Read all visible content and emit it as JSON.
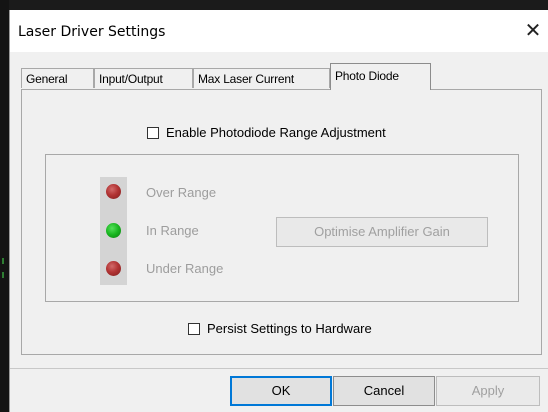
{
  "window": {
    "title": "Laser Driver Settings",
    "close_glyph": "✕"
  },
  "tabs": [
    {
      "label": "General",
      "active": false
    },
    {
      "label": "Input/Output",
      "active": false
    },
    {
      "label": "Max Laser Current",
      "active": false
    },
    {
      "label": "Photo Diode",
      "active": true
    }
  ],
  "photo_diode": {
    "enable_range_adjustment": {
      "label": "Enable Photodiode Range Adjustment",
      "checked": false
    },
    "indicators": [
      {
        "label": "Over Range",
        "color": "red"
      },
      {
        "label": "In Range",
        "color": "green"
      },
      {
        "label": "Under Range",
        "color": "red"
      }
    ],
    "optimise_button": {
      "label": "Optimise Amplifier Gain",
      "enabled": false
    },
    "persist_settings": {
      "label": "Persist Settings to Hardware",
      "checked": false
    }
  },
  "buttons": {
    "ok": "OK",
    "cancel": "Cancel",
    "apply": "Apply"
  },
  "colors": {
    "accent": "#0078d7",
    "led_red": "#b23434",
    "led_green": "#18b51f",
    "disabled_text": "#9d9d9d"
  }
}
